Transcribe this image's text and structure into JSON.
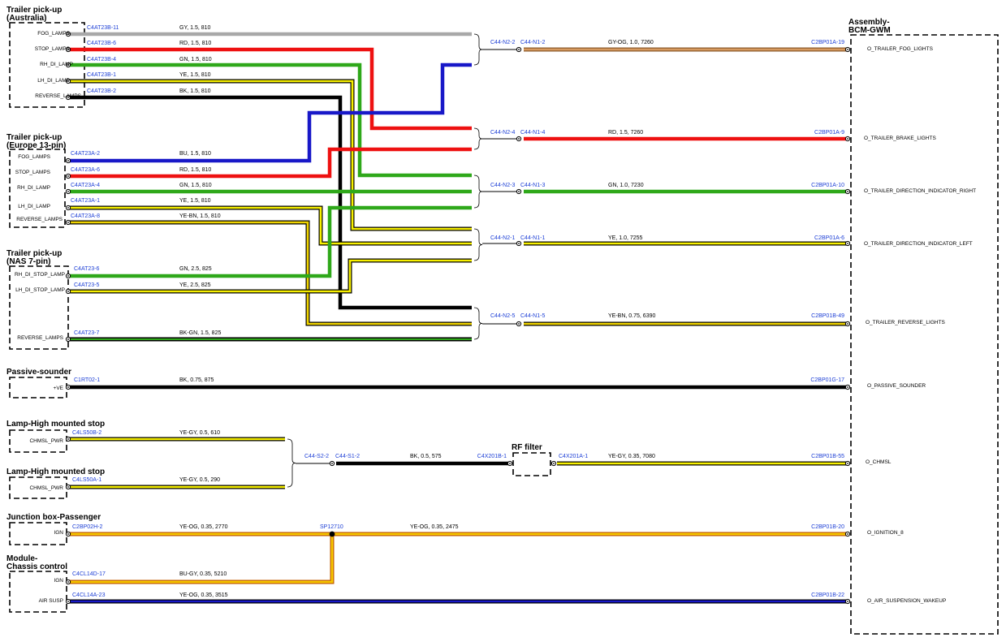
{
  "colors": {
    "GY": "#a8a8a8",
    "RD": "#ee1111",
    "GN": "#2fa81a",
    "YE": "#f7f000",
    "BK": "#000000",
    "BU": "#1818c8",
    "GY-OG": "#d79a60",
    "YE-GY": "#f7f000",
    "YE-OG": "#f7c800",
    "YE-BN": "#f0d400",
    "BU-GY": "#f7c800",
    "label_blue": "#1d3fd6"
  },
  "blocks": {
    "trailer_aus": {
      "title_l1": "Trailer pick-up",
      "title_l2": "(Australia)",
      "pins": [
        "FOG_LAMPS",
        "STOP_LAMPS",
        "RH_DI_LAMP",
        "LH_DI_LAMP",
        "REVERSE_LAMPS"
      ]
    },
    "trailer_eu": {
      "title_l1": "Trailer pick-up",
      "title_l2": "(Europe 13-pin)",
      "pins": [
        "FOG_LAMPS",
        "STOP_LAMPS",
        "RH_DI_LAMP",
        "LH_DI_LAMP",
        "REVERSE_LAMPS"
      ]
    },
    "trailer_nas": {
      "title_l1": "Trailer pick-up",
      "title_l2": "(NAS 7-pin)",
      "pins": [
        "RH_DI_STOP_LAMP",
        "LH_DI_STOP_LAMP",
        "REVERSE_LAMPS"
      ]
    },
    "passive_sounder": {
      "title": "Passive-sounder",
      "pin": "+VE"
    },
    "lamp_hms_1": {
      "title": "Lamp-High mounted stop",
      "pin": "CHMSL_PWR"
    },
    "lamp_hms_2": {
      "title": "Lamp-High mounted stop",
      "pin": "CHMSL_PWR"
    },
    "junction_box": {
      "title": "Junction box-Passenger",
      "pin": "IGN"
    },
    "module_chassis": {
      "title_l1": "Module-",
      "title_l2": "Chassis control",
      "pins": [
        "IGN",
        "AIR SUSP"
      ]
    },
    "rf_filter": {
      "title": "RF filter"
    },
    "bcm": {
      "title_l1": "Assembly-",
      "title_l2": "BCM-GWM",
      "pins": [
        "O_TRAILER_FOG_LIGHTS",
        "O_TRAILER_BRAKE_LIGHTS",
        "O_TRAILER_DIRECTION_INDICATOR_RIGHT",
        "O_TRAILER_DIRECTION_INDICATOR_LEFT",
        "O_TRAILER_REVERSE_LIGHTS",
        "O_PASSIVE_SOUNDER",
        "O_CHMSL",
        "O_IGNITION_8",
        "O_AIR_SUSPENSION_WAKEUP"
      ]
    }
  },
  "wires": {
    "aus": [
      {
        "conn": "C4AT23B-11",
        "spec": "GY, 1.5, 810"
      },
      {
        "conn": "C4AT23B-6",
        "spec": "RD, 1.5, 810"
      },
      {
        "conn": "C4AT23B-4",
        "spec": "GN, 1.5, 810"
      },
      {
        "conn": "C4AT23B-1",
        "spec": "YE, 1.5, 810"
      },
      {
        "conn": "C4AT23B-2",
        "spec": "BK, 1.5, 810"
      }
    ],
    "eu": [
      {
        "conn": "C4AT23A-2",
        "spec": "BU, 1.5, 810"
      },
      {
        "conn": "C4AT23A-6",
        "spec": "RD, 1.5, 810"
      },
      {
        "conn": "C4AT23A-4",
        "spec": "GN, 1.5, 810"
      },
      {
        "conn": "C4AT23A-1",
        "spec": "YE, 1.5, 810"
      },
      {
        "conn": "C4AT23A-8",
        "spec": "YE-BN, 1.5, 810"
      }
    ],
    "nas": [
      {
        "conn": "C4AT23-6",
        "spec": "GN, 2.5, 825"
      },
      {
        "conn": "C4AT23-5",
        "spec": "YE, 2.5, 825"
      },
      {
        "conn": "C4AT23-7",
        "spec": "BK-GN, 1.5, 825"
      }
    ],
    "out": [
      {
        "n2": "C44-N2-2",
        "n1": "C44-N1-2",
        "spec": "GY-OG, 1.0, 7260",
        "end": "C2BP01A-19"
      },
      {
        "n2": "C44-N2-4",
        "n1": "C44-N1-4",
        "spec": "RD, 1.5, 7260",
        "end": "C2BP01A-9"
      },
      {
        "n2": "C44-N2-3",
        "n1": "C44-N1-3",
        "spec": "GN, 1.0, 7230",
        "end": "C2BP01A-10"
      },
      {
        "n2": "C44-N2-1",
        "n1": "C44-N1-1",
        "spec": "YE, 1.0, 7255",
        "end": "C2BP01A-6"
      },
      {
        "n2": "C44-N2-5",
        "n1": "C44-N1-5",
        "spec": "YE-BN, 0.75, 6390",
        "end": "C2BP01B-49"
      }
    ],
    "sounder": {
      "conn": "C1RT02-1",
      "spec": "BK, 0.75, 875",
      "end": "C2BP01G-17"
    },
    "chmsl_1": {
      "conn": "C4LS50B-2",
      "spec": "YE-GY, 0.5, 610"
    },
    "chmsl_2": {
      "conn": "C4LS50A-1",
      "spec": "YE-GY, 0.5, 290"
    },
    "chmsl_splice": {
      "s2": "C44-S2-2",
      "s1": "C44-S1-2",
      "spec": "BK, 0.5, 575",
      "rf_in": "C4X201B-1"
    },
    "chmsl_out": {
      "conn": "C4X201A-1",
      "spec": "YE-GY, 0.35, 7080",
      "end": "C2BP01B-55"
    },
    "ign_1": {
      "conn": "C2BP02H-2",
      "spec": "YE-OG, 0.35, 2770"
    },
    "ign_splice": {
      "label": "SP12710",
      "spec": "YE-OG, 0.35, 2475",
      "end": "C2BP01B-20"
    },
    "ign_2": {
      "conn": "C4CL14D-17",
      "spec": "BU-GY, 0.35, 5210"
    },
    "air": {
      "conn": "C4CL14A-23",
      "spec": "YE-OG, 0.35, 3515",
      "end": "C2BP01B-22"
    }
  }
}
